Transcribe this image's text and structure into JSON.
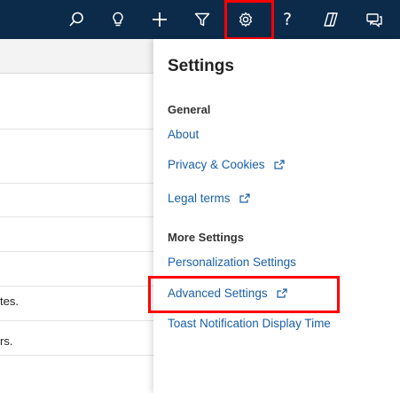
{
  "topbar": {
    "icons": [
      "search-icon",
      "lightbulb-icon",
      "plus-icon",
      "filter-icon",
      "gear-icon",
      "help-icon",
      "copilot-icon",
      "chat-icon"
    ],
    "help_glyph": "?"
  },
  "colors": {
    "topbar": "#0c2a4a",
    "link": "#1a5fa6",
    "highlight": "#ff0000"
  },
  "left": {
    "row6_text": "tes.",
    "row7_text": "rs."
  },
  "settings": {
    "title": "Settings",
    "general_label": "General",
    "about": "About",
    "privacy": "Privacy & Cookies",
    "legal": "Legal terms",
    "more_label": "More Settings",
    "personalization": "Personalization Settings",
    "advanced": "Advanced Settings",
    "toast": "Toast Notification Display Time"
  }
}
